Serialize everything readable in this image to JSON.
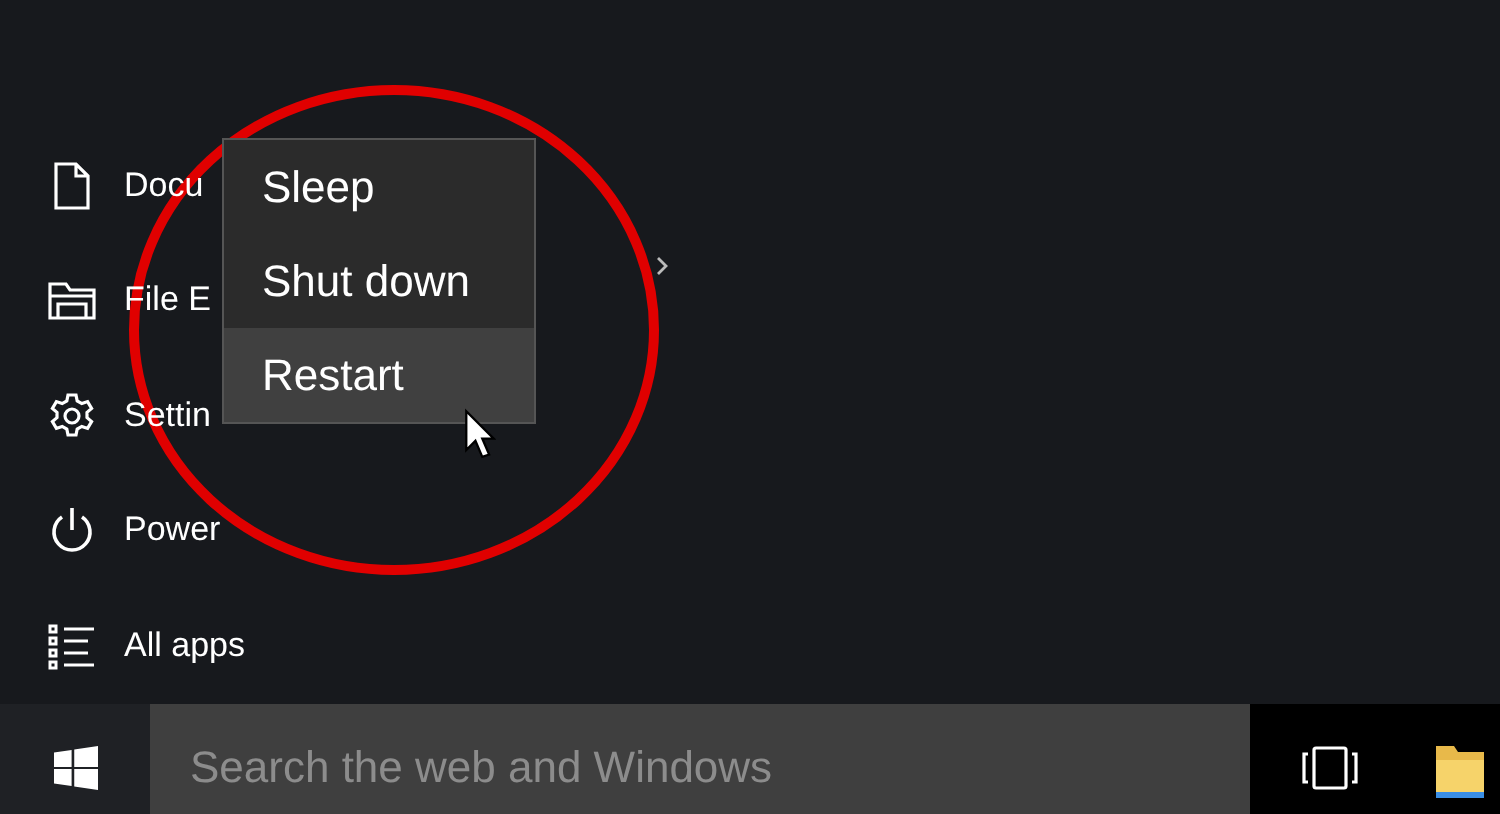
{
  "start_menu": {
    "items": [
      {
        "kind": "document",
        "label": "Docu"
      },
      {
        "kind": "folder",
        "label": "File E"
      },
      {
        "kind": "settings",
        "label": "Settin"
      },
      {
        "kind": "power",
        "label": "Power"
      },
      {
        "kind": "apps",
        "label": "All apps"
      }
    ]
  },
  "power_menu": {
    "items": [
      {
        "label": "Sleep",
        "selected": false
      },
      {
        "label": "Shut down",
        "selected": false
      },
      {
        "label": "Restart",
        "selected": true
      }
    ]
  },
  "taskbar": {
    "search": {
      "placeholder": "Search the web and Windows"
    }
  }
}
